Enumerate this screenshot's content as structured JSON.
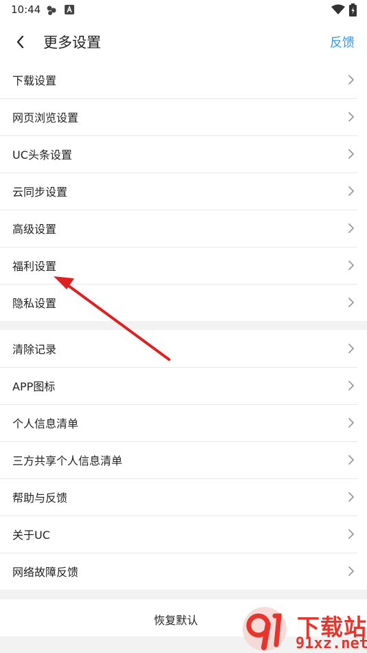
{
  "status_bar": {
    "time": "10:44"
  },
  "header": {
    "title": "更多设置",
    "feedback_label": "反馈"
  },
  "groups": [
    {
      "items": [
        {
          "label": "下载设置"
        },
        {
          "label": "网页浏览设置"
        },
        {
          "label": "UC头条设置"
        },
        {
          "label": "云同步设置"
        },
        {
          "label": "高级设置"
        },
        {
          "label": "福利设置"
        },
        {
          "label": "隐私设置"
        }
      ]
    },
    {
      "items": [
        {
          "label": "清除记录"
        },
        {
          "label": "APP图标"
        },
        {
          "label": "个人信息清单"
        },
        {
          "label": "三方共享个人信息清单"
        },
        {
          "label": "帮助与反馈"
        },
        {
          "label": "关于UC"
        },
        {
          "label": "网络故障反馈"
        }
      ]
    }
  ],
  "footer": {
    "restore_label": "恢复默认"
  },
  "watermark": {
    "text": "下载站",
    "url": "91xz.net"
  },
  "colors": {
    "accent": "#2e9bf0",
    "annotation": "#e02020",
    "watermark": "#e8342c"
  },
  "icons": [
    "back-arrow",
    "wifi",
    "battery",
    "chevron-right"
  ]
}
